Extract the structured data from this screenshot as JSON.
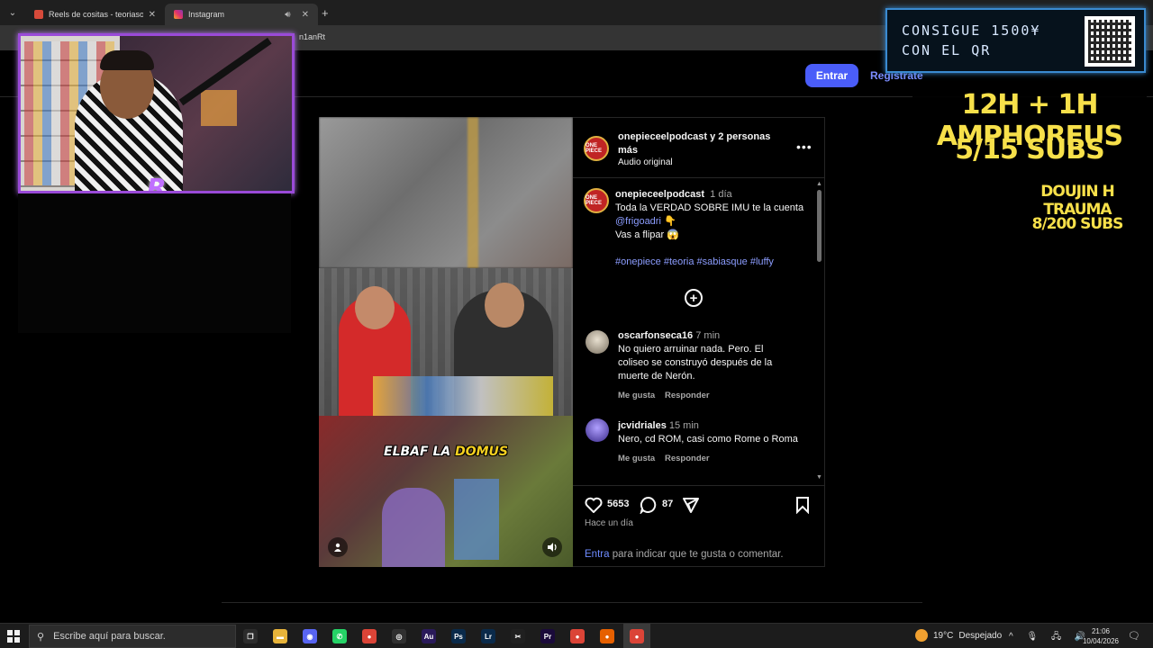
{
  "browser": {
    "tabs": [
      {
        "label": "Reels de cositas - teoriasonepie",
        "favicon_color": "#d64a3a",
        "active": false
      },
      {
        "label": "Instagram",
        "favicon_color": "#e1306c",
        "active": true
      }
    ],
    "close_glyph": "✕",
    "new_tab_glyph": "+",
    "menu_glyph": "⌄",
    "url_fragment": "n1anRt"
  },
  "instagram": {
    "login_label": "Entrar",
    "register_label": "Regístrate",
    "reel": {
      "overlay_caption_white": "ELBAF LA ",
      "overlay_caption_highlight": "DOMUS",
      "user_icon": "user-icon",
      "sound_icon": "volume-icon"
    },
    "post": {
      "header_title": "onepieceelpodcast y 2 personas más",
      "header_sub": "Audio original",
      "avatar_label": "ONE PIECE",
      "more_glyph": "•••",
      "author": "onepieceelpodcast",
      "author_time": "1 día",
      "caption_line1": "Toda la VERDAD SOBRE IMU te la cuenta",
      "caption_mention": "@frigoadri",
      "caption_mention_emoji": "👇",
      "caption_line3": "Vas a flipar 😱",
      "hashtags": "#onepiece #teoria #sabiasque #luffy",
      "plus_glyph": "+"
    },
    "comments": [
      {
        "user": "oscarfonseca16",
        "time": "7 min",
        "text_lines": [
          "No quiero arruinar nada. Pero. El",
          "coliseo se construyó después de la",
          "muerte de Nerón."
        ],
        "like_label": "Me gusta",
        "reply_label": "Responder",
        "avatar_color": "#c8c0b0"
      },
      {
        "user": "jcvidriales",
        "time": "15 min",
        "text_lines": [
          "Nero, cd ROM, casi como Rome o Roma"
        ],
        "like_label": "Me gusta",
        "reply_label": "Responder",
        "avatar_color": "#6a5ad0"
      }
    ],
    "actions": {
      "likes": "5653",
      "comments": "87",
      "posted_ago": "Hace un día",
      "prompt_link": "Entra",
      "prompt_rest": " para indicar que te gusta o comentar."
    }
  },
  "overlay": {
    "qr_line1": "CONSIGUE 1500¥",
    "qr_line2": "CON EL QR",
    "goal1_line1": "12H + 1H AMPHOREUS",
    "goal1_line2": "5/15 SUBS",
    "goal2_line1": "DOUJIN H TRAUMA",
    "goal2_line2": "8/200 SUBS",
    "cam_logo": "R",
    "accent_color": "#9a4ad8"
  },
  "taskbar": {
    "search_placeholder": "Escribe aquí para buscar.",
    "apps": [
      {
        "name": "task-view-icon",
        "glyph": "❐",
        "color": "#2c2c2c"
      },
      {
        "name": "file-explorer-icon",
        "glyph": "▬",
        "color": "#e8b43a"
      },
      {
        "name": "discord-icon",
        "glyph": "◉",
        "color": "#5865f2"
      },
      {
        "name": "whatsapp-icon",
        "glyph": "✆",
        "color": "#25d366"
      },
      {
        "name": "chrome-icon",
        "glyph": "●",
        "color": "#db4437"
      },
      {
        "name": "obs-icon",
        "glyph": "◎",
        "color": "#303030"
      },
      {
        "name": "audition-icon",
        "glyph": "Au",
        "color": "#2a1a5a"
      },
      {
        "name": "photoshop-icon",
        "glyph": "Ps",
        "color": "#0a2a4a"
      },
      {
        "name": "lightroom-icon",
        "glyph": "Lr",
        "color": "#0a2a4a"
      },
      {
        "name": "capcut-icon",
        "glyph": "✂",
        "color": "#202020"
      },
      {
        "name": "premiere-icon",
        "glyph": "Pr",
        "color": "#1a0a3a"
      },
      {
        "name": "chrome-icon-2",
        "glyph": "●",
        "color": "#db4437"
      },
      {
        "name": "firefox-icon",
        "glyph": "●",
        "color": "#e66000"
      },
      {
        "name": "chrome-icon-3",
        "glyph": "●",
        "color": "#db4437"
      }
    ],
    "weather_temp": "19°C",
    "weather_desc": "Despejado",
    "tray_glyphs": "^ 🎙 🖧 🔊",
    "clock_time": "21:06",
    "clock_date": "10/04/2026",
    "notif_glyph": "🗨"
  }
}
